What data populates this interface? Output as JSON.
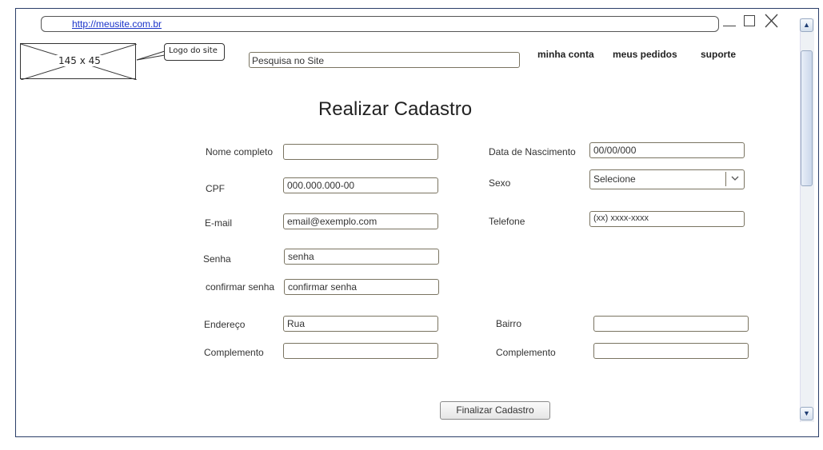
{
  "browser": {
    "url": "http://meusite.com.br"
  },
  "header": {
    "logo_placeholder": "145 x 45",
    "logo_callout": "Logo do site",
    "search_placeholder": "Pesquisa no Site",
    "nav": [
      "minha conta",
      "meus pedidos",
      "suporte"
    ]
  },
  "form": {
    "title": "Realizar Cadastro",
    "nome_label": "Nome completo",
    "nome_value": "",
    "cpf_label": "CPF",
    "cpf_value": "000.000.000-00",
    "email_label": "E-mail",
    "email_value": "email@exemplo.com",
    "senha_label": "Senha",
    "senha_value": "senha",
    "confirmar_label": "confirmar senha",
    "confirmar_value": "confirmar senha",
    "endereco_label": "Endereço",
    "endereco_value": "Rua",
    "complemento_left_label": "Complemento",
    "complemento_left_value": "",
    "nascimento_label": "Data de Nascimento",
    "nascimento_value": "00/00/000",
    "sexo_label": "Sexo",
    "sexo_value": "Selecione",
    "telefone_label": "Telefone",
    "telefone_value": "(xx) xxxx-xxxx",
    "bairro_label": "Bairro",
    "bairro_value": "",
    "complemento_right_label": "Complemento",
    "complemento_right_value": "",
    "submit_label": "Finalizar Cadastro"
  },
  "icons": {
    "minimize": "minimize-icon",
    "maximize": "maximize-icon",
    "close": "close-icon",
    "scroll_up": "scroll-up-icon",
    "scroll_down": "scroll-down-icon",
    "dropdown": "chevron-down-icon"
  }
}
